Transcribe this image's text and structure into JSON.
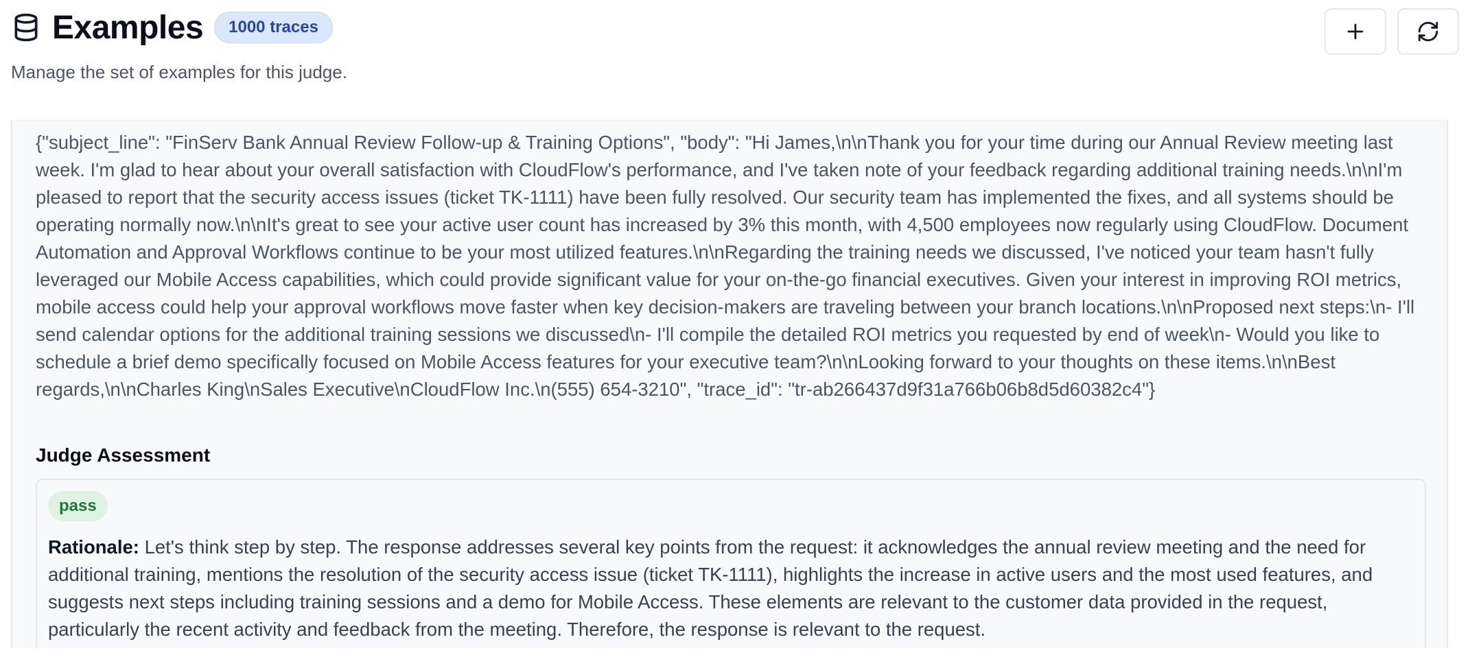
{
  "header": {
    "icon": "database-icon",
    "title": "Examples",
    "badge": "1000 traces",
    "subtitle": "Manage the set of examples for this judge.",
    "actions": [
      {
        "icon": "plus-icon"
      },
      {
        "icon": "refresh-icon"
      }
    ]
  },
  "example": {
    "output": "{\"subject_line\": \"FinServ Bank Annual Review Follow-up & Training Options\", \"body\": \"Hi James,\\n\\nThank you for your time during our Annual Review meeting last week. I'm glad to hear about your overall satisfaction with CloudFlow's performance, and I've taken note of your feedback regarding additional training needs.\\n\\nI'm pleased to report that the security access issues (ticket TK-1111) have been fully resolved. Our security team has implemented the fixes, and all systems should be operating normally now.\\n\\nIt's great to see your active user count has increased by 3% this month, with 4,500 employees now regularly using CloudFlow. Document Automation and Approval Workflows continue to be your most utilized features.\\n\\nRegarding the training needs we discussed, I've noticed your team hasn't fully leveraged our Mobile Access capabilities, which could provide significant value for your on-the-go financial executives. Given your interest in improving ROI metrics, mobile access could help your approval workflows move faster when key decision-makers are traveling between your branch locations.\\n\\nProposed next steps:\\n- I'll send calendar options for the additional training sessions we discussed\\n- I'll compile the detailed ROI metrics you requested by end of week\\n- Would you like to schedule a brief demo specifically focused on Mobile Access features for your executive team?\\n\\nLooking forward to your thoughts on these items.\\n\\nBest regards,\\n\\nCharles King\\nSales Executive\\nCloudFlow Inc.\\n(555) 654-3210\", \"trace_id\": \"tr-ab266437d9f31a766b06b8d5d60382c4\"}"
  },
  "assessment": {
    "section_title": "Judge Assessment",
    "result": "pass",
    "rationale_label": "Rationale:",
    "rationale": "Let's think step by step. The response addresses several key points from the request: it acknowledges the annual review meeting and the need for additional training, mentions the resolution of the security access issue (ticket TK-1111), highlights the increase in active users and the most used features, and suggests next steps including training sessions and a demo for Mobile Access. These elements are relevant to the customer data provided in the request, particularly the recent activity and feedback from the meeting. Therefore, the response is relevant to the request."
  },
  "colors": {
    "badge_bg": "#dbe7fb",
    "badge_text": "#2946a3",
    "pass_bg": "#dff3e4",
    "pass_text": "#1f7a3a",
    "panel_bg": "#f8f9fb"
  }
}
